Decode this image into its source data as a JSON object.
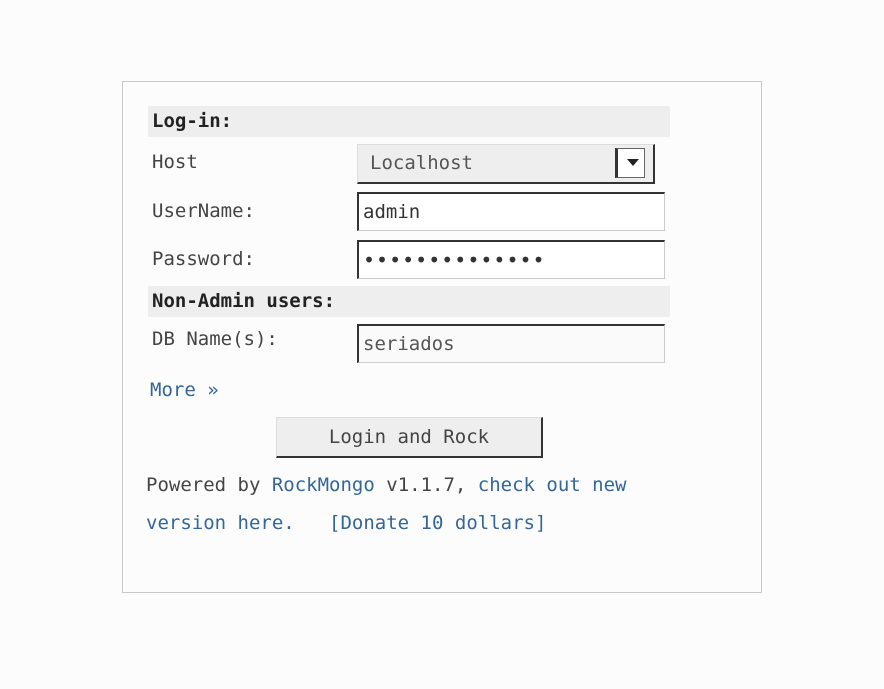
{
  "login": {
    "section_title": "Log-in:",
    "host_label": "Host",
    "host_value": "Localhost",
    "username_label": "UserName:",
    "username_value": "admin",
    "password_label": "Password:",
    "password_value": "••••••••••••••"
  },
  "non_admin": {
    "section_title": "Non-Admin users:",
    "db_label": "DB Name(s):",
    "db_value": "seriados"
  },
  "more_link": "More »",
  "submit_label": "Login and Rock",
  "footer": {
    "powered_by": "Powered by",
    "rockmongo_link": "RockMongo",
    "version": "v1.1.7,",
    "check_link": "check out new version here.",
    "donate_link": "[Donate 10 dollars]"
  }
}
